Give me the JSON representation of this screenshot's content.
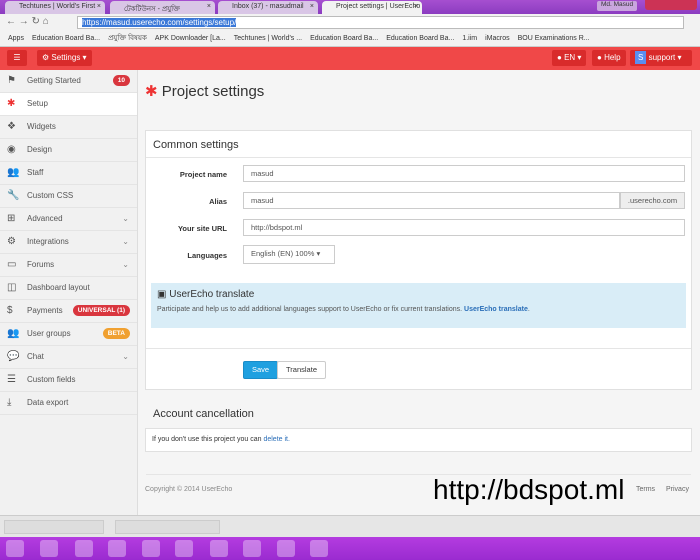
{
  "browser": {
    "tabs": [
      {
        "label": "Techtunes | World's First"
      },
      {
        "label": "টেকটিউনস - প্রযুক্তি"
      },
      {
        "label": "Inbox (37) - masudmail"
      },
      {
        "label": "Project settings | UserEcho"
      }
    ],
    "user": "Md. Masud",
    "url": "https://masud.userecho.com/settings/setup/",
    "bookmarks": [
      "Apps",
      "Education Board Ba...",
      "প্রযুক্তি বিষয়ক",
      "APK Downloader [La...",
      "Techtunes | World's ...",
      "Education Board Ba...",
      "Education Board Ba...",
      "1.iim",
      "iMacros",
      "BOU Examinations R..."
    ]
  },
  "appbar": {
    "menu_icon": "☰",
    "settings": "Settings ▾",
    "lang": "EN ▾",
    "help": "Help",
    "avatar": "S",
    "user": "support ▾"
  },
  "sidebar": {
    "items": [
      {
        "label": "Getting Started",
        "icon": "⚑",
        "badge": "10",
        "badge_color": "#d9363e"
      },
      {
        "label": "Setup",
        "icon": "✱"
      },
      {
        "label": "Widgets",
        "icon": "❖"
      },
      {
        "label": "Design",
        "icon": "◉"
      },
      {
        "label": "Staff",
        "icon": "👥"
      },
      {
        "label": "Custom CSS",
        "icon": "🔧"
      },
      {
        "label": "Advanced",
        "icon": "⊞",
        "chevron": "⌄"
      },
      {
        "label": "Integrations",
        "icon": "⚙",
        "chevron": "⌄"
      },
      {
        "label": "Forums",
        "icon": "▭",
        "chevron": "⌄"
      },
      {
        "label": "Dashboard layout",
        "icon": "◫"
      },
      {
        "label": "Payments",
        "icon": "$",
        "badge": "UNIVERSAL (1)",
        "badge_color": "#d9363e"
      },
      {
        "label": "User groups",
        "icon": "👥",
        "badge": "BETA",
        "badge_color": "#f0a030"
      },
      {
        "label": "Chat",
        "icon": "💬",
        "chevron": "⌄"
      },
      {
        "label": "Custom fields",
        "icon": "☰"
      },
      {
        "label": "Data export",
        "icon": "⤓"
      }
    ]
  },
  "page": {
    "title": "Project settings",
    "common": "Common settings",
    "fields": {
      "project_name_label": "Project name",
      "project_name": "masud",
      "alias_label": "Alias",
      "alias": "masud",
      "alias_suffix": ".userecho.com",
      "site_url_label": "Your site URL",
      "site_url": "http://bdspot.ml",
      "languages_label": "Languages",
      "languages": "English (EN) 100% ▾"
    },
    "translate": {
      "title": "UserEcho translate",
      "text": "Participate and help us to add additional languages support to UserEcho or fix current translations.",
      "link": "UserEcho translate"
    },
    "save": "Save",
    "translate_btn": "Translate",
    "cancel_title": "Account cancellation",
    "cancel_text": "If you don't use this project you can",
    "cancel_link": "delete it.",
    "copyright": "Copyright © 2014 UserEcho",
    "terms": "Terms",
    "privacy": "Privacy",
    "watermark": "http://bdspot.ml"
  }
}
